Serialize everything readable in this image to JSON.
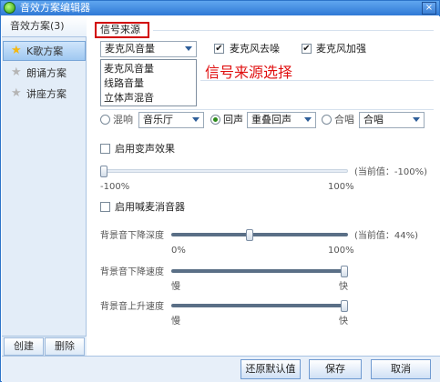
{
  "window": {
    "title": "音效方案编辑器",
    "close_glyph": "×"
  },
  "sidebar": {
    "tab": "音效方案(3)",
    "items": [
      {
        "label": "K歌方案",
        "active": true
      },
      {
        "label": "朗诵方案",
        "active": false
      },
      {
        "label": "讲座方案",
        "active": false
      }
    ],
    "create_label": "创建",
    "delete_label": "删除"
  },
  "signal": {
    "section_title": "信号来源",
    "source_value": "麦克风音量",
    "options": [
      "麦克风音量",
      "线路音量",
      "立体声混音"
    ],
    "annotation": "信号来源选择",
    "noise_reduction_label": "麦克风去噪",
    "noise_reduction_checked": true,
    "boost_label": "麦克风加强",
    "boost_checked": true
  },
  "effects": {
    "reverb_label": "混响",
    "reverb_value": "音乐厅",
    "echo_label": "回声",
    "echo_value": "重叠回声",
    "chorus_label": "合唱",
    "chorus_value": "合唱",
    "selected": "echo"
  },
  "voice_change": {
    "label": "启用变声效果",
    "checked": false,
    "min_label": "-100%",
    "max_label": "100%",
    "current_label": "(当前值：-100%)",
    "value_percent": -100
  },
  "vocal_remove": {
    "label": "启用喊麦消音器",
    "checked": false
  },
  "bg_depth": {
    "label": "背景音下降深度",
    "min_label": "0%",
    "max_label": "100%",
    "current_label": "(当前值：44%)",
    "value_percent": 44
  },
  "bg_fall_speed": {
    "label": "背景音下降速度",
    "min_label": "慢",
    "max_label": "快",
    "value_fraction": 1.0
  },
  "bg_rise_speed": {
    "label": "背景音上升速度",
    "min_label": "慢",
    "max_label": "快",
    "value_fraction": 1.0
  },
  "footer": {
    "restore_label": "还原默认值",
    "save_label": "保存",
    "cancel_label": "取消"
  },
  "colors": {
    "accent": "#2f79d6",
    "annotation": "#e01010",
    "highlight_border": "#d10000"
  }
}
